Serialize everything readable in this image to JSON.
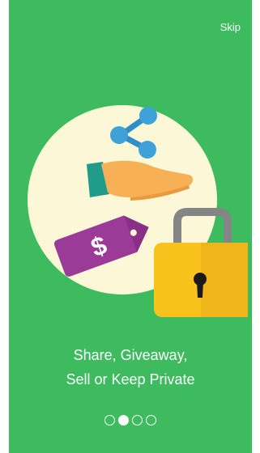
{
  "header": {
    "skip_label": "Skip"
  },
  "onboarding": {
    "caption_line1": "Share, Giveaway,",
    "caption_line2": "Sell or Keep Private",
    "illustration_icons": [
      "share-icon",
      "giving-hand-icon",
      "price-tag-icon",
      "padlock-icon"
    ],
    "price_tag_symbol": "$",
    "page_indicator": {
      "total": 4,
      "active_index": 1
    }
  },
  "colors": {
    "background": "#3dbb5e",
    "circle": "#fbf7d7",
    "share_blue": "#3ea2d9",
    "hand": "#f7b055",
    "sleeve": "#1f9b8a",
    "tag": "#9b3b97",
    "lock_body": "#f9c21d",
    "lock_shackle": "#858585"
  }
}
